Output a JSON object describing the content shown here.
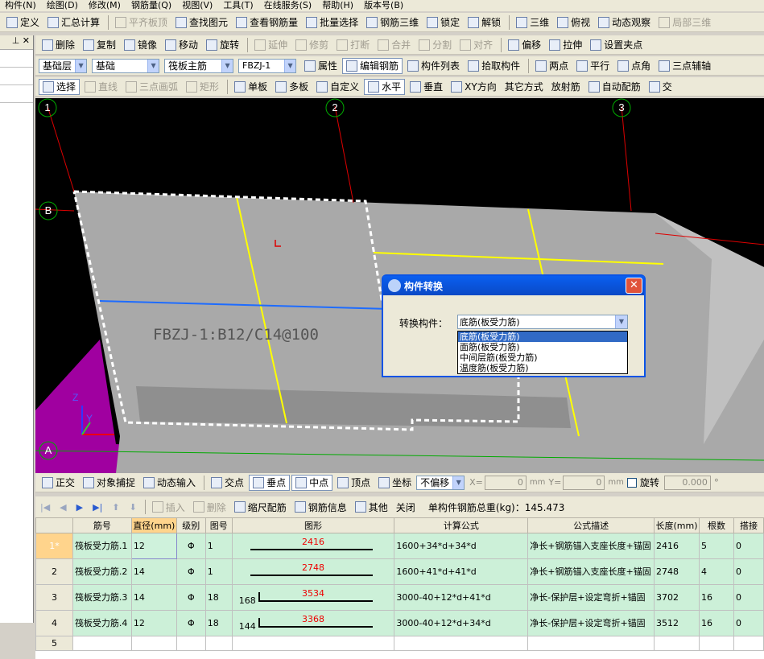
{
  "menu": [
    "构件(N)",
    "绘图(D)",
    "修改(M)",
    "钢筋量(Q)",
    "视图(V)",
    "工具(T)",
    "在线服务(S)",
    "帮助(H)",
    "版本号(B)"
  ],
  "toolbar1": [
    {
      "label": "定义",
      "icon": "define-icon",
      "enabled": true
    },
    {
      "label": "汇总计算",
      "icon": "sigma-icon",
      "enabled": true
    },
    {
      "label": "平齐板顶",
      "icon": "align-top-icon",
      "enabled": false
    },
    {
      "label": "查找图元",
      "icon": "binoculars-icon",
      "enabled": true
    },
    {
      "label": "查看钢筋量",
      "icon": "glasses-icon",
      "enabled": true
    },
    {
      "label": "批量选择",
      "icon": "batch-select-icon",
      "enabled": true
    },
    {
      "label": "钢筋三维",
      "icon": "rebar-3d-icon",
      "enabled": true
    },
    {
      "label": "锁定",
      "icon": "lock-icon",
      "enabled": true
    },
    {
      "label": "解锁",
      "icon": "unlock-icon",
      "enabled": true
    },
    {
      "label": "三维",
      "icon": "cube-icon",
      "enabled": true
    },
    {
      "label": "俯视",
      "icon": "top-view-icon",
      "enabled": true
    },
    {
      "label": "动态观察",
      "icon": "orbit-icon",
      "enabled": true
    },
    {
      "label": "局部三维",
      "icon": "local-3d-icon",
      "enabled": false
    }
  ],
  "toolbar2": [
    {
      "label": "删除",
      "icon": "eraser-icon",
      "enabled": true
    },
    {
      "label": "复制",
      "icon": "copy-icon",
      "enabled": true
    },
    {
      "label": "镜像",
      "icon": "mirror-icon",
      "enabled": true
    },
    {
      "label": "移动",
      "icon": "move-icon",
      "enabled": true
    },
    {
      "label": "旋转",
      "icon": "rotate-icon",
      "enabled": true
    },
    {
      "label": "延伸",
      "icon": "extend-icon",
      "enabled": false
    },
    {
      "label": "修剪",
      "icon": "trim-icon",
      "enabled": false
    },
    {
      "label": "打断",
      "icon": "break-icon",
      "enabled": false
    },
    {
      "label": "合并",
      "icon": "merge-icon",
      "enabled": false
    },
    {
      "label": "分割",
      "icon": "split-icon",
      "enabled": false
    },
    {
      "label": "对齐",
      "icon": "align-icon",
      "enabled": false
    },
    {
      "label": "偏移",
      "icon": "offset-icon",
      "enabled": true
    },
    {
      "label": "拉伸",
      "icon": "stretch-icon",
      "enabled": true
    },
    {
      "label": "设置夹点",
      "icon": "grip-icon",
      "enabled": true
    }
  ],
  "toolbar3": {
    "layer": "基础层",
    "type": "基础",
    "subtype": "筏板主筋",
    "element": "FBZJ-1",
    "buttons": [
      {
        "label": "属性",
        "icon": "properties-icon"
      },
      {
        "label": "编辑钢筋",
        "icon": "edit-rebar-icon"
      },
      {
        "label": "构件列表",
        "icon": "list-icon"
      },
      {
        "label": "拾取构件",
        "icon": "pick-icon"
      },
      {
        "label": "两点",
        "icon": "two-point-icon"
      },
      {
        "label": "平行",
        "icon": "parallel-icon"
      },
      {
        "label": "点角",
        "icon": "point-angle-icon"
      },
      {
        "label": "三点辅轴",
        "icon": "three-point-axis-icon"
      }
    ]
  },
  "toolbar4": [
    {
      "label": "选择",
      "icon": "cursor-icon",
      "enabled": true
    },
    {
      "label": "直线",
      "icon": "line-icon",
      "enabled": false
    },
    {
      "label": "三点画弧",
      "icon": "arc-icon",
      "enabled": false
    },
    {
      "label": "矩形",
      "icon": "rect-icon",
      "enabled": false
    },
    {
      "label": "单板",
      "icon": "single-slab-icon",
      "enabled": true
    },
    {
      "label": "多板",
      "icon": "multi-slab-icon",
      "enabled": true
    },
    {
      "label": "自定义",
      "icon": "custom-icon",
      "enabled": true
    },
    {
      "label": "水平",
      "icon": "horizontal-icon",
      "enabled": true
    },
    {
      "label": "垂直",
      "icon": "vertical-icon",
      "enabled": true
    },
    {
      "label": "XY方向",
      "icon": "xy-icon",
      "enabled": true
    },
    {
      "label": "其它方式",
      "icon": "",
      "enabled": true
    },
    {
      "label": "放射筋",
      "icon": "",
      "enabled": true
    },
    {
      "label": "自动配筋",
      "icon": "auto-rebar-icon",
      "enabled": true
    },
    {
      "label": "交",
      "icon": "intersect-icon",
      "enabled": true
    }
  ],
  "viewport": {
    "axes": [
      "1",
      "2",
      "3",
      "B",
      "A"
    ],
    "slab_label": "FBZJ-1:B12/C14@100",
    "axis_letters": [
      "Z",
      "Y"
    ]
  },
  "dialog": {
    "title": "构件转换",
    "field_label": "转换构件：",
    "selected": "底筋(板受力筋)",
    "options": [
      "底筋(板受力筋)",
      "面筋(板受力筋)",
      "中间层筋(板受力筋)",
      "温度筋(板受力筋)"
    ]
  },
  "snapbar": {
    "items": [
      "正交",
      "对象捕捉",
      "动态输入",
      "交点",
      "垂点",
      "中点",
      "顶点",
      "坐标"
    ],
    "offset_mode": "不偏移",
    "x_label": "X=",
    "x_value": "0",
    "y_label": "Y=",
    "y_value": "0",
    "unit": "mm",
    "rotate_label": "旋转",
    "rotate_value": "0.000",
    "degree": "°"
  },
  "rebarbar": {
    "buttons": [
      "插入",
      "删除",
      "缩尺配筋",
      "钢筋信息",
      "其他",
      "关闭"
    ],
    "total_label": "单构件钢筋总重(kg)：145.473"
  },
  "table": {
    "headers": [
      "",
      "筋号",
      "直径(mm)",
      "级别",
      "图号",
      "图形",
      "计算公式",
      "公式描述",
      "长度(mm)",
      "根数",
      "搭接"
    ],
    "rows": [
      {
        "rn": "1*",
        "name": "筏板受力筋.1",
        "dia": "12",
        "grade": "Φ",
        "fig": "1",
        "shape_len": "2416",
        "hook": "",
        "formula": "1600+34*d+34*d",
        "desc": "净长+钢筋锚入支座长度+锚固",
        "length": "2416",
        "count": "5",
        "lap": "0"
      },
      {
        "rn": "2",
        "name": "筏板受力筋.2",
        "dia": "14",
        "grade": "Φ",
        "fig": "1",
        "shape_len": "2748",
        "hook": "",
        "formula": "1600+41*d+41*d",
        "desc": "净长+钢筋锚入支座长度+锚固",
        "length": "2748",
        "count": "4",
        "lap": "0"
      },
      {
        "rn": "3",
        "name": "筏板受力筋.3",
        "dia": "14",
        "grade": "Φ",
        "fig": "18",
        "shape_len": "3534",
        "hook": "168",
        "formula": "3000-40+12*d+41*d",
        "desc": "净长-保护层+设定弯折+锚固",
        "length": "3702",
        "count": "16",
        "lap": "0"
      },
      {
        "rn": "4",
        "name": "筏板受力筋.4",
        "dia": "12",
        "grade": "Φ",
        "fig": "18",
        "shape_len": "3368",
        "hook": "144",
        "formula": "3000-40+12*d+34*d",
        "desc": "净长-保护层+设定弯折+锚固",
        "length": "3512",
        "count": "16",
        "lap": "0"
      },
      {
        "rn": "5",
        "name": "",
        "dia": "",
        "grade": "",
        "fig": "",
        "shape_len": "",
        "hook": "",
        "formula": "",
        "desc": "",
        "length": "",
        "count": "",
        "lap": ""
      }
    ]
  }
}
